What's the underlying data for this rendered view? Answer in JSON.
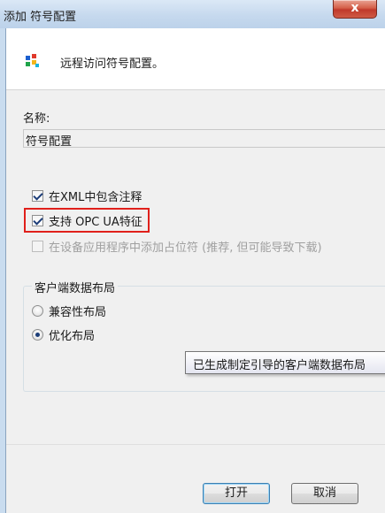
{
  "window": {
    "title": "添加 符号配置",
    "close_glyph": "x"
  },
  "header": {
    "icon": "symbol-config-icon",
    "text": "远程访问符号配置。"
  },
  "form": {
    "name_label": "名称:",
    "name_value": "符号配置",
    "checkboxes": [
      {
        "label": "在XML中包含注释",
        "checked": true,
        "enabled": true
      },
      {
        "label": "支持 OPC UA特征",
        "checked": true,
        "enabled": true
      },
      {
        "label": "在设备应用程序中添加占位符 (推荐, 但可能导致下载)",
        "checked": false,
        "enabled": false
      }
    ],
    "layout_group": {
      "title": "客户端数据布局",
      "options": [
        {
          "label": "兼容性布局",
          "selected": false
        },
        {
          "label": "优化布局",
          "selected": true
        }
      ]
    }
  },
  "tooltip": {
    "text": "已生成制定引导的客户端数据布局"
  },
  "buttons": {
    "ok": "打开",
    "cancel": "取消"
  },
  "colors": {
    "highlight_border": "#e0201b",
    "close_button": "#c0392b"
  }
}
